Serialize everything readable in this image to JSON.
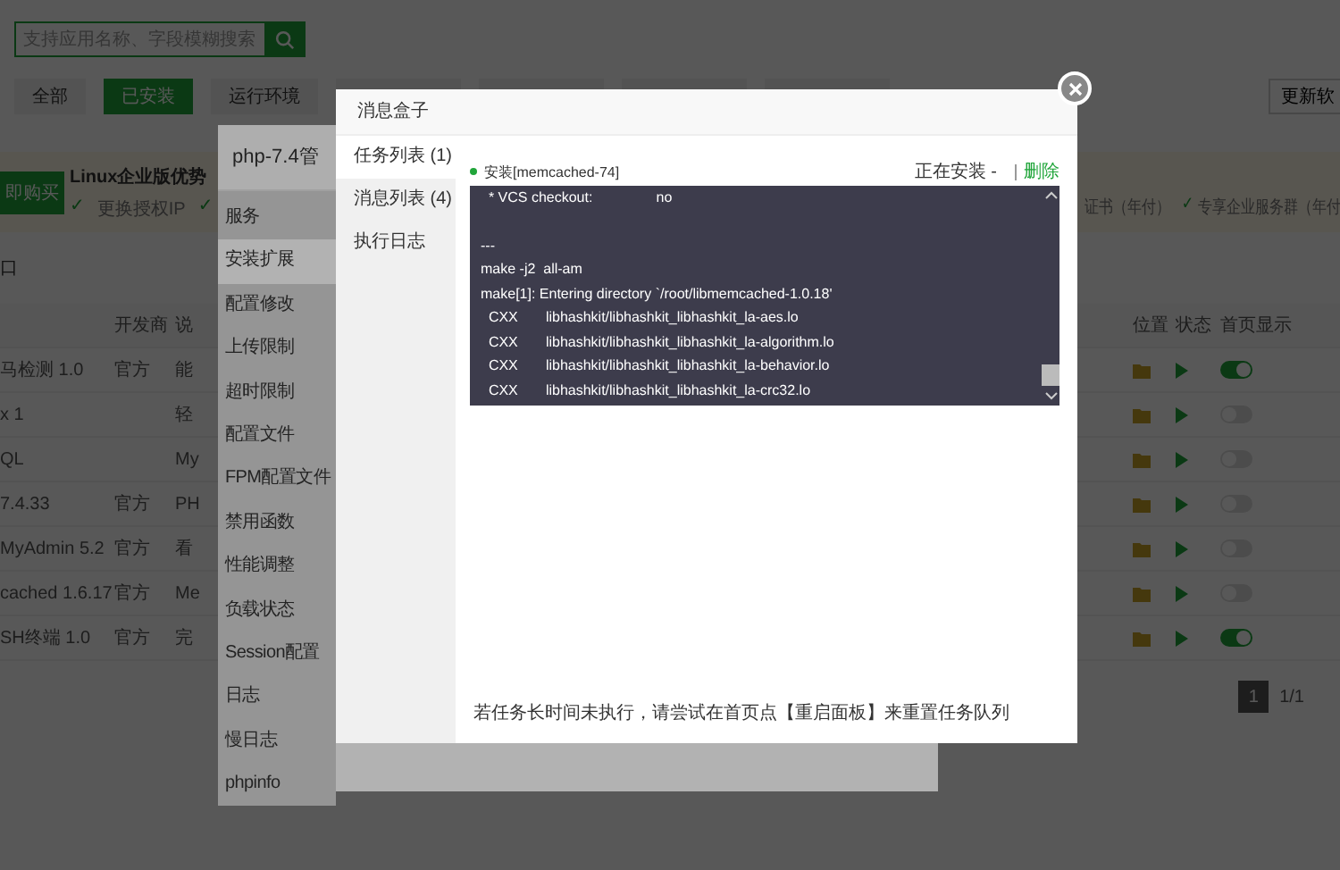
{
  "search": {
    "placeholder": "支持应用名称、字段模糊搜索"
  },
  "filters": [
    {
      "label": "全部",
      "selected": false
    },
    {
      "label": "已安装",
      "selected": true
    },
    {
      "label": "运行环境",
      "selected": false
    }
  ],
  "update_button": "更新软",
  "banner": {
    "buy_button": "即购买",
    "title": "Linux企业版优势",
    "features": [
      {
        "check": "✓",
        "text": "更换授权IP"
      },
      {
        "check": "✓"
      }
    ],
    "right_features": [
      {
        "text": "证书（年付）"
      },
      {
        "check": "✓",
        "text": "专享企业服务群（年付"
      }
    ]
  },
  "section_label": "口",
  "table": {
    "columns": [
      {
        "label": "开发商"
      },
      {
        "label": "说"
      },
      {
        "label": "位置"
      },
      {
        "label": "状态"
      },
      {
        "label": "首页显示"
      }
    ],
    "rows": [
      {
        "name": "马检测 1.0",
        "developer": "官方",
        "column_3": "能",
        "home_display": true
      },
      {
        "name": "x 1",
        "column_3": "轻",
        "home_display": false
      },
      {
        "name": "QL",
        "column_3": "My",
        "home_display": false
      },
      {
        "name": "7.4.33",
        "developer": "官方",
        "column_3": "PH",
        "home_display": false
      },
      {
        "name": "MyAdmin 5.2",
        "developer": "官方",
        "column_3": "看",
        "home_display": false
      },
      {
        "name": "cached 1.6.17",
        "developer": "官方",
        "column_3": "Me",
        "home_display": false
      },
      {
        "name": "SH终端 1.0",
        "developer": "官方",
        "column_3": "完",
        "home_display": true
      }
    ]
  },
  "pagination": {
    "pages": [
      {
        "label": "1",
        "selected": true
      }
    ],
    "summary": "1/1"
  },
  "php_panel": {
    "title": "php-7.4管",
    "menu": [
      {
        "label": "服务",
        "selected": false
      },
      {
        "label": "安装扩展",
        "selected": true
      },
      {
        "label": "配置修改",
        "selected": false
      },
      {
        "label": "上传限制",
        "selected": false
      },
      {
        "label": "超时限制",
        "selected": false
      },
      {
        "label": "配置文件",
        "selected": false
      },
      {
        "label": "FPM配置文件",
        "selected": false
      },
      {
        "label": "禁用函数",
        "selected": false
      },
      {
        "label": "性能调整",
        "selected": false
      },
      {
        "label": "负载状态",
        "selected": false
      },
      {
        "label": "Session配置",
        "selected": false
      },
      {
        "label": "日志",
        "selected": false
      },
      {
        "label": "慢日志",
        "selected": false
      },
      {
        "label": "phpinfo",
        "selected": false
      }
    ]
  },
  "modal": {
    "title": "消息盒子",
    "tabs": [
      {
        "label": "任务列表 (1)",
        "selected": true
      },
      {
        "label": "消息列表 (4)",
        "selected": false
      },
      {
        "label": "执行日志",
        "selected": false
      }
    ],
    "task": {
      "name": "安装[memcached-74]",
      "status": "正在安装 -",
      "action": "删除"
    },
    "log_blocks": [
      {
        "lines": [
          "  * VCS checkout:                no"
        ]
      },
      {
        "lines": [
          "---",
          "make -j2  all-am",
          "make[1]: Entering directory `/root/libmemcached-1.0.18'",
          "  CXX       libhashkit/libhashkit_libhashkit_la-aes.lo",
          "  CXX       libhashkit/libhashkit_libhashkit_la-algorithm.lo",
          "  CXX       libhashkit/libhashkit_libhashkit_la-behavior.lo",
          "  CXX       libhashkit/libhashkit_libhashkit_la-crc32.lo"
        ]
      }
    ],
    "note": "若任务长时间未执行，请尝试在首页点【重启面板】来重置任务队列"
  }
}
